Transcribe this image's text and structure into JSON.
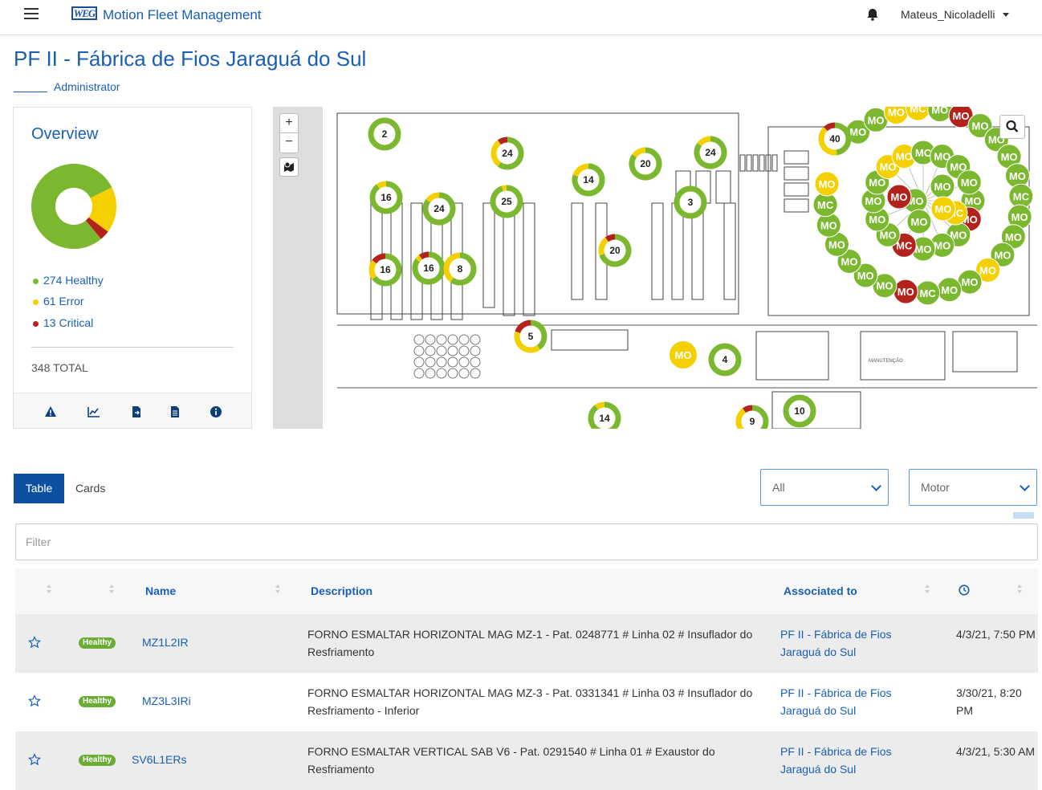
{
  "header": {
    "logo_text": "WEG",
    "app_title": "Motion Fleet Management",
    "user_name": "Mateus_Nicoladelli"
  },
  "page": {
    "title": "PF II - Fábrica de Fios Jaraguá do Sul",
    "role": "Administrator"
  },
  "overview": {
    "title": "Overview",
    "status": {
      "healthy": {
        "count": 274,
        "label": "274 Healthy",
        "color": "#7cb82f"
      },
      "error": {
        "count": 61,
        "label": "61 Error",
        "color": "#f5d000"
      },
      "critical": {
        "count": 13,
        "label": "13 Critical",
        "color": "#b3221c"
      }
    },
    "total_label": "348 TOTAL",
    "footer_icons": [
      "warning-icon",
      "trend-chart-icon",
      "export-file-icon",
      "report-icon",
      "info-icon"
    ]
  },
  "map": {
    "zoom_in": "+",
    "zoom_out": "−",
    "clusters": [
      {
        "label": "2",
        "error": 0,
        "critical": 0
      },
      {
        "label": "24",
        "error": 0.3,
        "critical": 0.1
      },
      {
        "label": "20",
        "error": 0.15,
        "critical": 0
      },
      {
        "label": "24",
        "error": 0.15,
        "critical": 0
      },
      {
        "label": "14",
        "error": 0.2,
        "critical": 0
      },
      {
        "label": "25",
        "error": 0.05,
        "critical": 0
      },
      {
        "label": "16",
        "error": 0.1,
        "critical": 0
      },
      {
        "label": "24",
        "error": 0.15,
        "critical": 0
      },
      {
        "label": "3",
        "error": 0,
        "critical": 0
      },
      {
        "label": "20",
        "error": 0.2,
        "critical": 0.1
      },
      {
        "label": "16",
        "error": 0.2,
        "critical": 0.15
      },
      {
        "label": "16",
        "error": 0.05,
        "critical": 0.1
      },
      {
        "label": "8",
        "error": 0.4,
        "critical": 0
      },
      {
        "label": "5",
        "error": 0.4,
        "critical": 0.2
      },
      {
        "label": "4",
        "error": 0,
        "critical": 0
      },
      {
        "label": "14",
        "error": 0.1,
        "critical": 0
      },
      {
        "label": "9",
        "error": 0.3,
        "critical": 0.1
      },
      {
        "label": "10",
        "error": 0,
        "critical": 0
      },
      {
        "label": "40",
        "error": 0.4,
        "critical": 0.12
      }
    ],
    "device_markers": [
      "MO",
      "MC"
    ],
    "room_labels": [
      "MANUTENÇÃO"
    ]
  },
  "view_tabs": {
    "table": "Table",
    "cards": "Cards"
  },
  "filters": {
    "status_select": "All",
    "type_select": "Motor",
    "filter_placeholder": "Filter"
  },
  "table": {
    "columns": {
      "name": "Name",
      "description": "Description",
      "associated": "Associated to"
    },
    "rows": [
      {
        "status": "Healthy",
        "name": "MZ1L2IR",
        "description": "FORNO ESMALTAR HORIZONTAL MAG MZ-1 - Pat. 0248771 # Linha 02 # Insuflador do Resfriamento",
        "associated": "PF II - Fábrica de Fios Jaraguá do Sul",
        "date": "4/3/21, 7:50 PM"
      },
      {
        "status": "Healthy",
        "name": "MZ3L3IRi",
        "description": "FORNO ESMALTAR HORIZONTAL MAG MZ-3 - Pat. 0331341 # Linha 03 # Insuflador do Resfriamento - Inferior",
        "associated": "PF II - Fábrica de Fios Jaraguá do Sul",
        "date": "3/30/21, 8:20 PM"
      },
      {
        "status": "Healthy",
        "name": "SV6L1ERs",
        "description": "FORNO ESMALTAR VERTICAL SAB V6 - Pat. 0291540 # Linha 01 # Exaustor do Resfriamento",
        "associated": "PF II - Fábrica de Fios Jaraguá do Sul",
        "date": "4/3/21, 5:30 AM"
      }
    ]
  }
}
